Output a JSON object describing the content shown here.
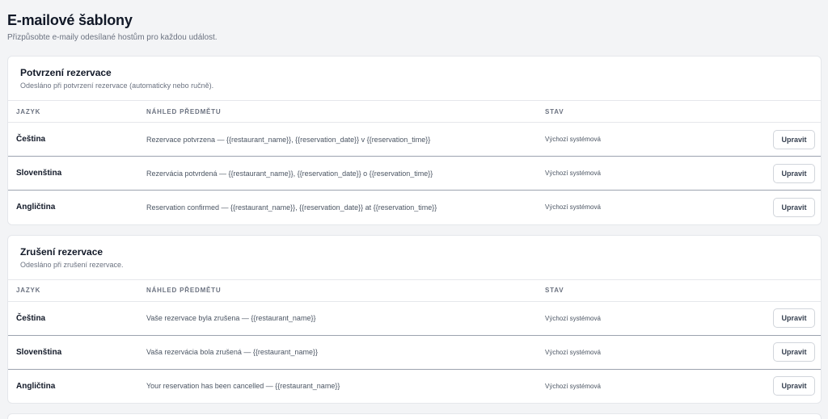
{
  "page": {
    "title": "E-mailové šablony",
    "subtitle": "Přizpůsobte e-maily odesílané hostům pro každou událost."
  },
  "columns": {
    "language": "JAZYK",
    "subject": "NÁHLED PŘEDMĚTU",
    "status": "STAV"
  },
  "sections": [
    {
      "title": "Potvrzení rezervace",
      "description": "Odesláno při potvrzení rezervace (automaticky nebo ručně).",
      "rows": [
        {
          "language": "Čeština",
          "subject": "Rezervace potvrzena — {{restaurant_name}}, {{reservation_date}} v {{reservation_time}}",
          "status": "Výchozí systémová",
          "action": "Upravit"
        },
        {
          "language": "Slovenština",
          "subject": "Rezervácia potvrdená — {{restaurant_name}}, {{reservation_date}} o {{reservation_time}}",
          "status": "Výchozí systémová",
          "action": "Upravit"
        },
        {
          "language": "Angličtina",
          "subject": "Reservation confirmed — {{restaurant_name}}, {{reservation_date}} at {{reservation_time}}",
          "status": "Výchozí systémová",
          "action": "Upravit"
        }
      ]
    },
    {
      "title": "Zrušení rezervace",
      "description": "Odesláno při zrušení rezervace.",
      "rows": [
        {
          "language": "Čeština",
          "subject": "Vaše rezervace byla zrušena — {{restaurant_name}}",
          "status": "Výchozí systémová",
          "action": "Upravit"
        },
        {
          "language": "Slovenština",
          "subject": "Vaša rezervácia bola zrušená — {{restaurant_name}}",
          "status": "Výchozí systémová",
          "action": "Upravit"
        },
        {
          "language": "Angličtina",
          "subject": "Your reservation has been cancelled — {{restaurant_name}}",
          "status": "Výchozí systémová",
          "action": "Upravit"
        }
      ]
    }
  ]
}
